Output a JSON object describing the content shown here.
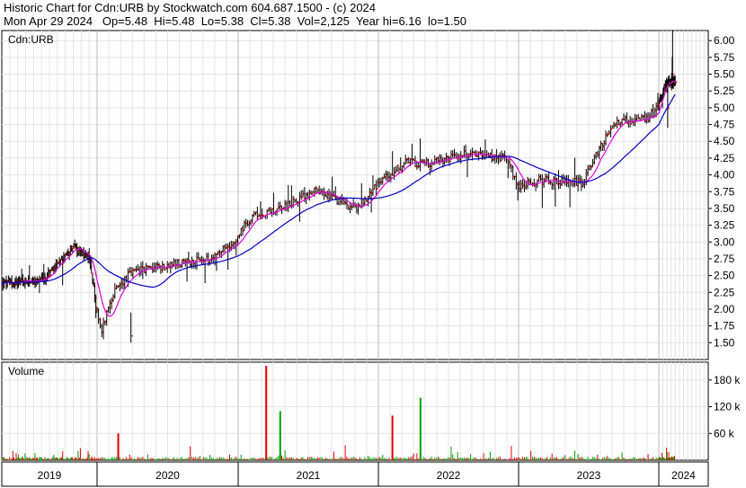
{
  "header": {
    "line1": "Historic Chart for Cdn:URB by Stockwatch.com 604.687.1500 - (c) 2024",
    "line2": "Mon Apr 29 2024   Op=5.48  Hi=5.48  Lo=5.38  Cl=5.38  Vol=2,125  Year hi=6.16  lo=1.50"
  },
  "price_panel": {
    "symbol_label": "Cdn:URB"
  },
  "volume_panel": {
    "title": "Volume"
  },
  "chart_data": [
    {
      "type": "bar",
      "subtype": "ohlc-daily-with-moving-averages",
      "symbol": "Cdn:URB",
      "x_labels": [
        "2019",
        "2020",
        "2021",
        "2022",
        "2023",
        "2024"
      ],
      "y_ticks": [
        "1.50",
        "1.75",
        "2.00",
        "2.25",
        "2.50",
        "2.75",
        "3.00",
        "3.25",
        "3.50",
        "3.75",
        "4.00",
        "4.25",
        "4.50",
        "4.75",
        "5.00",
        "5.25",
        "5.50",
        "5.75",
        "6.00"
      ],
      "ylim": [
        1.25,
        6.15
      ],
      "year_hi": 6.16,
      "year_lo": 1.5,
      "last_bar": {
        "date": "Mon Apr 29 2024",
        "open": 5.48,
        "high": 5.48,
        "low": 5.38,
        "close": 5.38,
        "volume": 2125
      },
      "price_path_approx": {
        "t": [
          0,
          0.55,
          0.98,
          1.2,
          1.35,
          1.45,
          1.6,
          1.75,
          2.2,
          2.4,
          2.6,
          2.75,
          3.0,
          3.35,
          3.75,
          3.95,
          4.2,
          4.4,
          4.75,
          5.15,
          5.25,
          5.45,
          5.85,
          6.15,
          6.45,
          6.72,
          6.85,
          7.0
        ],
        "close": [
          2.38,
          2.42,
          2.92,
          2.8,
          1.65,
          2.2,
          2.5,
          2.6,
          2.7,
          2.75,
          3.05,
          3.38,
          3.5,
          3.75,
          3.5,
          3.9,
          4.18,
          4.18,
          4.3,
          4.25,
          3.82,
          3.92,
          3.88,
          4.8,
          4.82,
          5.3,
          5.4,
          5.38
        ]
      },
      "series": [
        {
          "name": "",
          "style": "short moving average",
          "color": "#e000e0"
        },
        {
          "name": "",
          "style": "long moving average",
          "color": "#0000c8"
        }
      ],
      "bar_color": "#000000",
      "close_tick_color": "#cc0000",
      "grid": true
    },
    {
      "type": "bar",
      "title": "Volume",
      "y_ticks": [
        "60 k",
        "120 k",
        "180 k"
      ],
      "ylim": [
        0,
        220000
      ],
      "notable_spikes": [
        {
          "approx_year": 2020.15,
          "volume": 60000,
          "color": "red"
        },
        {
          "approx_year": 2021.2,
          "volume": 212000,
          "color": "red"
        },
        {
          "approx_year": 2021.3,
          "volume": 110000,
          "color": "green"
        },
        {
          "approx_year": 2022.1,
          "volume": 100000,
          "color": "red"
        },
        {
          "approx_year": 2022.3,
          "volume": 140000,
          "color": "green"
        }
      ],
      "up_color": "#00a000",
      "down_color": "#e00000",
      "grid": true
    }
  ]
}
